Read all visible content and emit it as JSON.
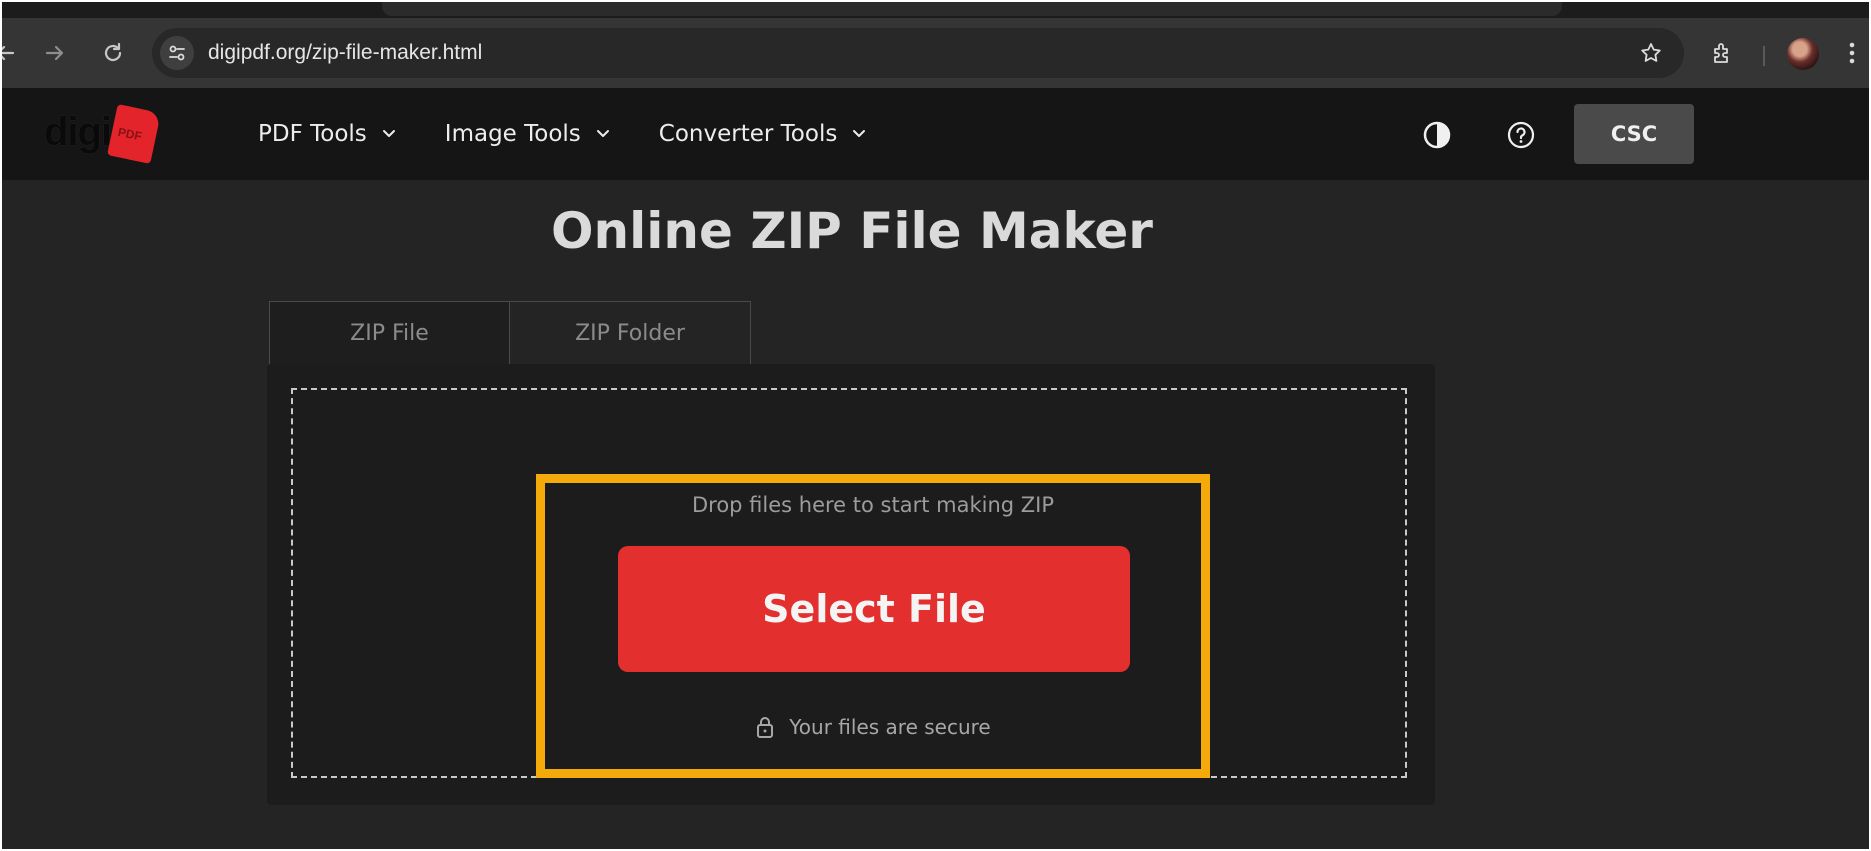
{
  "browser": {
    "url": "digipdf.org/zip-file-maker.html",
    "icons": [
      "back-arrow-icon",
      "forward-arrow-icon",
      "reload-icon",
      "site-settings-icon",
      "bookmark-star-icon",
      "extensions-puzzle-icon",
      "profile-avatar",
      "kebab-menu-icon"
    ]
  },
  "header": {
    "logo_text": "digi",
    "logo_badge": "PDF",
    "nav": [
      {
        "label": "PDF Tools"
      },
      {
        "label": "Image Tools"
      },
      {
        "label": "Converter Tools"
      }
    ],
    "csc_label": "CSC",
    "icons": [
      "contrast-theme-icon",
      "help-circle-icon"
    ]
  },
  "main": {
    "title": "Online ZIP File Maker",
    "tabs": [
      {
        "label": "ZIP File",
        "active": true
      },
      {
        "label": "ZIP Folder",
        "active": false
      }
    ],
    "drop_text": "Drop files here to start making ZIP",
    "select_button": "Select File",
    "secure_text": "Your files are secure"
  },
  "colors": {
    "background": "#242424",
    "header": "#151515",
    "accent_red": "#e3302e",
    "highlight_orange": "#f5aa0c"
  }
}
